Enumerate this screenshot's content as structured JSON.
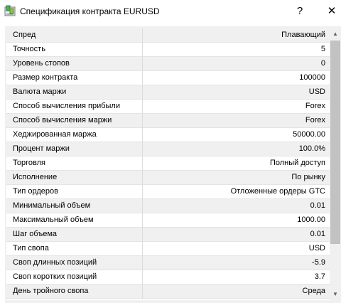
{
  "window": {
    "title": "Спецификация контракта EURUSD",
    "help_label": "?",
    "close_label": "✕",
    "icon": "app-icon"
  },
  "specs": [
    {
      "name": "Спред",
      "value": "Плавающий"
    },
    {
      "name": "Точность",
      "value": "5"
    },
    {
      "name": "Уровень стопов",
      "value": "0"
    },
    {
      "name": "Размер контракта",
      "value": "100000"
    },
    {
      "name": "Валюта маржи",
      "value": "USD"
    },
    {
      "name": "Способ вычисления прибыли",
      "value": "Forex"
    },
    {
      "name": "Способ вычисления маржи",
      "value": "Forex"
    },
    {
      "name": "Хеджированная маржа",
      "value": "50000.00"
    },
    {
      "name": "Процент маржи",
      "value": "100.0%"
    },
    {
      "name": "Торговля",
      "value": "Полный доступ"
    },
    {
      "name": "Исполнение",
      "value": "По рынку"
    },
    {
      "name": "Тип ордеров",
      "value": "Отложенные ордеры GTC"
    },
    {
      "name": "Минимальный объем",
      "value": "0.01"
    },
    {
      "name": "Максимальный объем",
      "value": "1000.00"
    },
    {
      "name": "Шаг объема",
      "value": "0.01"
    },
    {
      "name": "Тип свопа",
      "value": "USD"
    },
    {
      "name": "Своп длинных позиций",
      "value": "-5.9"
    },
    {
      "name": "Своп коротких позиций",
      "value": "3.7"
    },
    {
      "name": "День тройного свопа",
      "value": "Среда"
    }
  ],
  "scrollbar": {
    "up_icon": "▲",
    "down_icon": "▼"
  }
}
